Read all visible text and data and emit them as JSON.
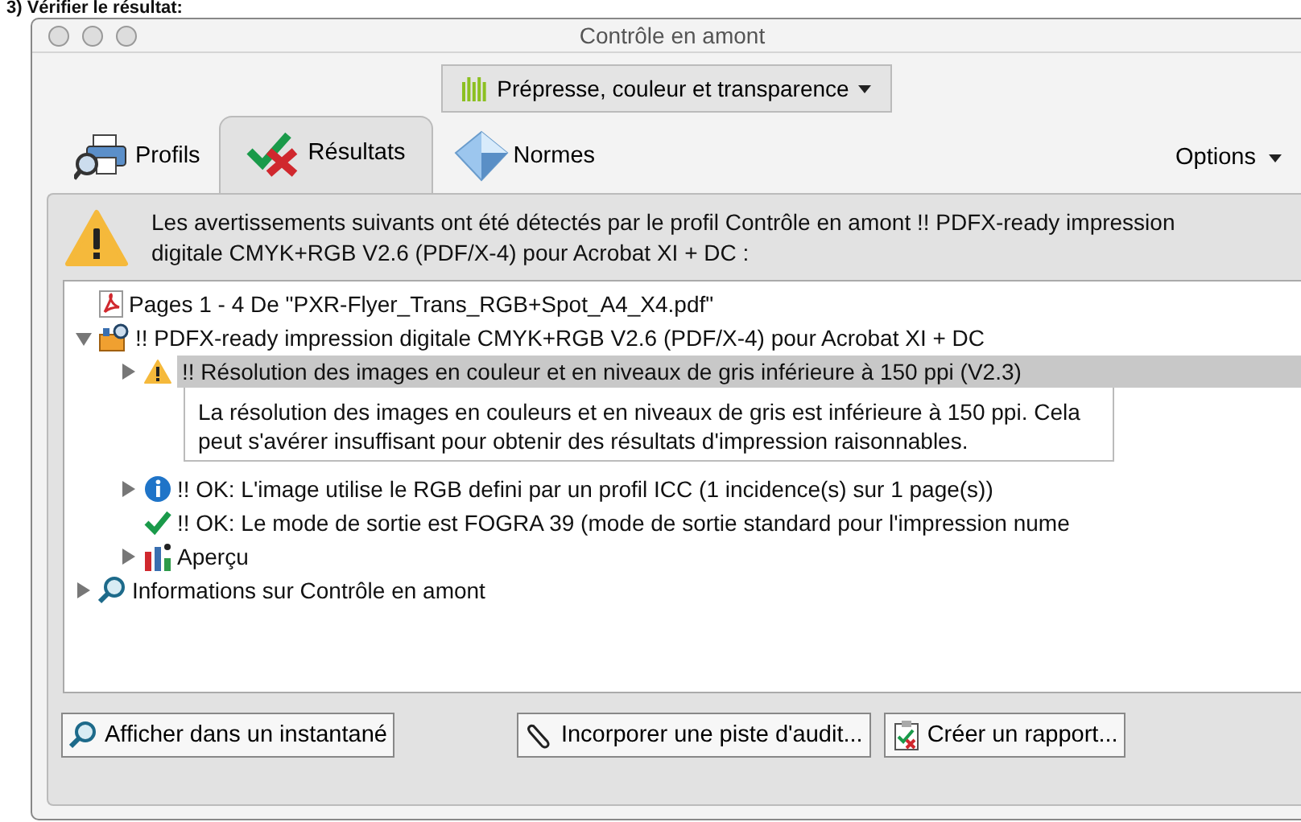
{
  "heading": "3) Vérifier le résultat:",
  "window": {
    "title": "Contrôle en amont"
  },
  "category_menu": {
    "label": "Prépresse, couleur et transparence"
  },
  "tabs": [
    {
      "label": "Profils",
      "selected": false
    },
    {
      "label": "Résultats",
      "selected": true
    },
    {
      "label": "Normes",
      "selected": false
    }
  ],
  "options_menu": {
    "label": "Options"
  },
  "message": "Les avertissements suivants ont été détectés par le profil Contrôle en amont !! PDFX-ready impression digitale CMYK+RGB V2.6 (PDF/X-4) pour Acrobat XI + DC :",
  "tree": [
    {
      "label": "Pages 1 - 4 De \"PXR-Flyer_Trans_RGB+Spot_A4_X4.pdf\"",
      "kind": "pdf",
      "selected": false
    },
    {
      "label": "!! PDFX-ready impression digitale CMYK+RGB V2.6 (PDF/X-4) pour Acrobat XI + DC",
      "kind": "profile",
      "expanded": true,
      "selected": false,
      "children": [
        {
          "label": "!! Résolution des images en couleur et en niveaux de gris inférieure à 150 ppi (V2.3)",
          "kind": "warning",
          "expanded": false,
          "selected": true,
          "description": "La résolution des images en couleurs et en niveaux de gris est inférieure à 150 ppi. Cela peut s'avérer insuffisant pour obtenir des résultats d'impression raisonnables."
        },
        {
          "label": "!! OK: L'image utilise le RGB defini par un profil ICC (1 incidence(s) sur 1 page(s))",
          "kind": "info",
          "expanded": false,
          "selected": false
        },
        {
          "label": "!! OK: Le mode de sortie est FOGRA 39 (mode de sortie standard pour l'impression nume",
          "kind": "check",
          "selected": false
        },
        {
          "label": "Aperçu",
          "kind": "overview",
          "expanded": false,
          "selected": false
        }
      ]
    },
    {
      "label": "Informations sur Contrôle en amont",
      "kind": "about",
      "expanded": false,
      "selected": false
    }
  ],
  "buttons": [
    {
      "label": "Afficher dans un instantané"
    },
    {
      "label": "Incorporer une piste d'audit..."
    },
    {
      "label": "Créer un rapport..."
    }
  ]
}
